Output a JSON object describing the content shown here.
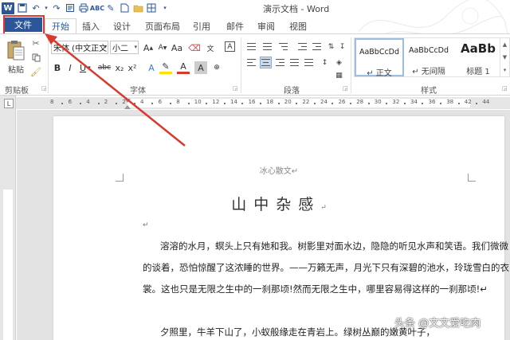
{
  "window": {
    "title": "演示文档 - Word"
  },
  "tabs": [
    "文件",
    "开始",
    "插入",
    "设计",
    "页面布局",
    "引用",
    "邮件",
    "审阅",
    "视图"
  ],
  "ribbon": {
    "clipboard": {
      "paste_label": "粘贴",
      "group_label": "剪贴板"
    },
    "font": {
      "font_name": "宋体 (中文正文",
      "font_size": "小二",
      "group_label": "字体",
      "grow": "A",
      "shrink": "A",
      "aa": "Aa",
      "bold": "B",
      "italic": "I",
      "underline": "U",
      "strike": "abc",
      "sub": "x₂",
      "sup": "x²",
      "highlight": "A",
      "color": "A",
      "charborder": "A"
    },
    "paragraph": {
      "group_label": "段落"
    },
    "styles": {
      "group_label": "样式",
      "items": [
        {
          "preview": "AaBbCcDd",
          "name": "↵ 正文"
        },
        {
          "preview": "AaBbCcDd",
          "name": "↵ 无间隔"
        },
        {
          "preview": "AaBb",
          "name": "标题 1"
        }
      ]
    }
  },
  "ruler": {
    "numbers": [
      "8",
      "6",
      "4",
      "2",
      "2",
      "4",
      "6",
      "8",
      "10",
      "12",
      "14",
      "16",
      "18",
      "20",
      "22",
      "24",
      "26",
      "28",
      "30",
      "32",
      "34",
      "36",
      "38",
      "42",
      "44"
    ]
  },
  "document": {
    "header": "冰心散文↵",
    "title": "山中杂感",
    "title_mark": "↵",
    "empty_mark": "↵",
    "paragraph1": [
      "溶溶的水月，螟头上只有她和我。树影里对面水边，隐隐的听见水声和笑语。我们微微",
      "的谈着，恐怕惊醒了这浓睡的世界。——万籁无声，月光下只有深碧的池水，玲珑雪白的衣",
      "裳。这也只是无限之生中的一刹那顷!然而无限之生中，哪里容易得这样的一刹那顷!↵"
    ],
    "paragraph2": "夕照里，牛羊下山了，小蚁般缘走在青岩上。绿树丛巅的嫩黄叶子，"
  },
  "watermark": "头条 @文文爱吃肉",
  "colors": {
    "accent": "#2b579a",
    "highlight": "#d9392e"
  }
}
